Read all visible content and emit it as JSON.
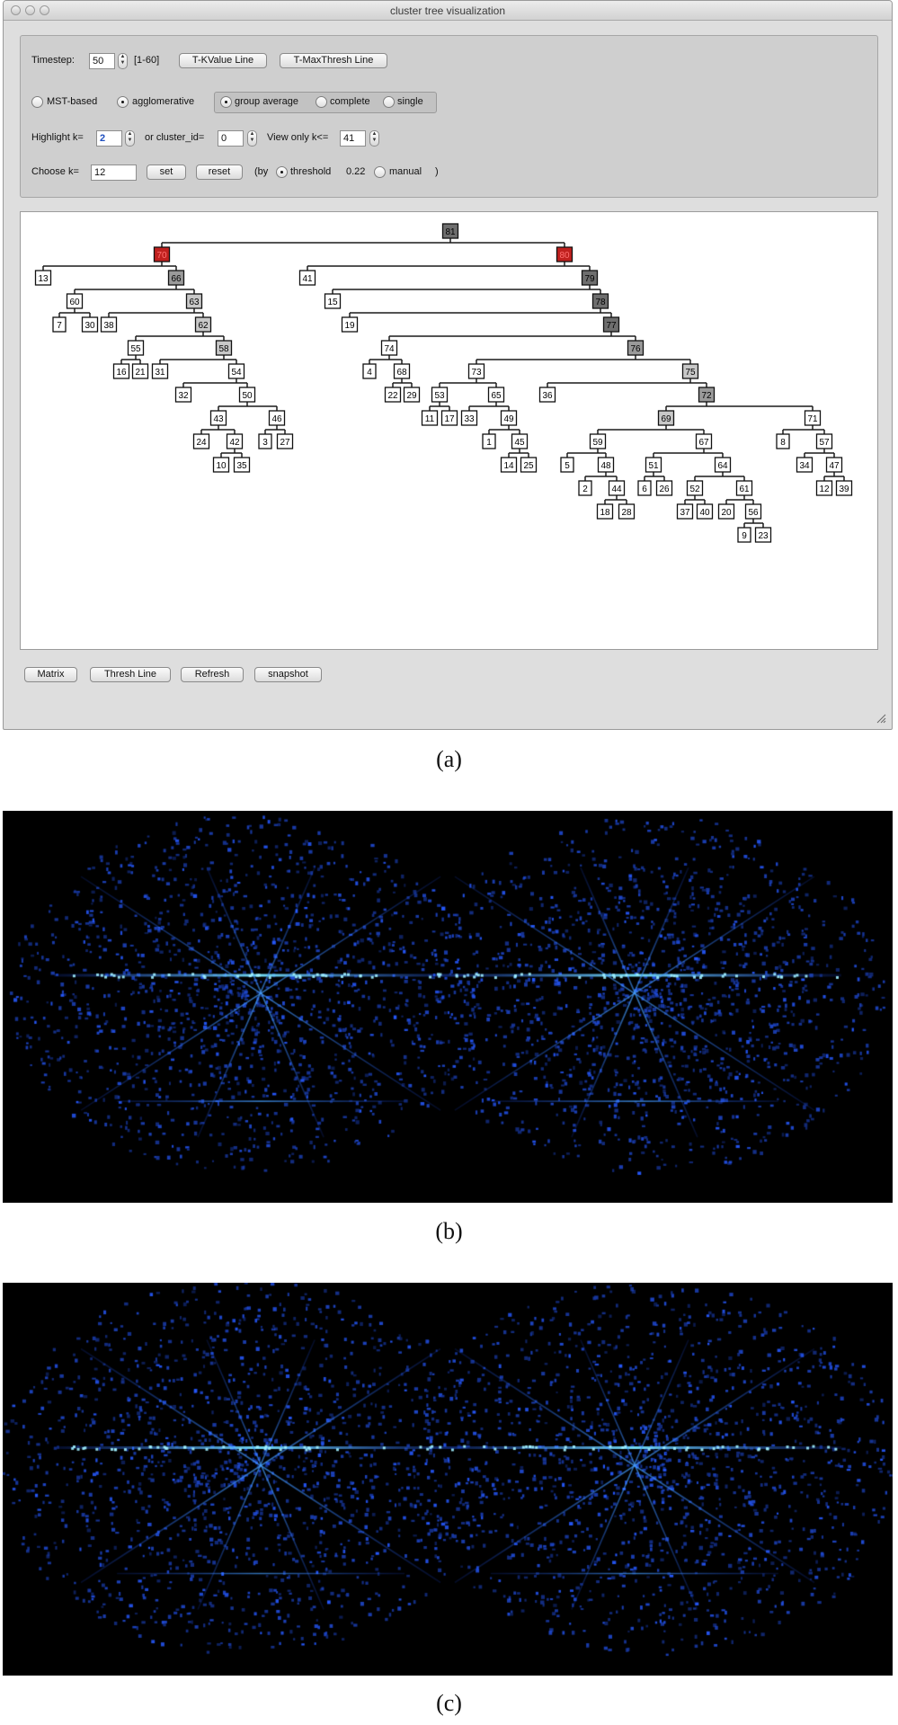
{
  "window": {
    "title": "cluster tree visualization"
  },
  "controls": {
    "timestep_label": "Timestep:",
    "timestep_value": "50",
    "timestep_range": "[1-60]",
    "tkvalue_button": "T-KValue Line",
    "tmaxthresh_button": "T-MaxThresh Line",
    "mst_label": "MST-based",
    "agglomerative_label": "agglomerative",
    "group_average_label": "group average",
    "complete_label": "complete",
    "single_label": "single",
    "highlight_label": "Highlight k=",
    "highlight_value": "2",
    "cluster_id_label": "or cluster_id=",
    "cluster_id_value": "0",
    "view_only_label": "View only k<=",
    "view_only_value": "41",
    "choose_k_label": "Choose k=",
    "choose_k_value": "12",
    "set_button": "set",
    "reset_button": "reset",
    "by_label": "(by",
    "threshold_label": "threshold",
    "threshold_value": "0.22",
    "manual_label": "manual",
    "close_paren": ")"
  },
  "bottom_buttons": {
    "matrix": "Matrix",
    "thresh_line": "Thresh Line",
    "refresh": "Refresh",
    "snapshot": "snapshot"
  },
  "tree": {
    "colors": {
      "highlight": "#c0201e",
      "dark": "#6e6e6e",
      "medium": "#9a9a9a",
      "light": "#c8c8c8",
      "leaf": "#ffffff"
    },
    "nodes": [
      {
        "id": "81",
        "parent": null,
        "shade": "dark"
      },
      {
        "id": "70",
        "parent": "81",
        "shade": "highlight"
      },
      {
        "id": "80",
        "parent": "81",
        "shade": "highlight"
      },
      {
        "id": "13",
        "parent": "70",
        "shade": "leaf"
      },
      {
        "id": "66",
        "parent": "70",
        "shade": "medium"
      },
      {
        "id": "60",
        "parent": "66",
        "shade": "leaf"
      },
      {
        "id": "63",
        "parent": "66",
        "shade": "light"
      },
      {
        "id": "7",
        "parent": "60",
        "shade": "leaf"
      },
      {
        "id": "30",
        "parent": "60",
        "shade": "leaf"
      },
      {
        "id": "38",
        "parent": "63",
        "shade": "leaf"
      },
      {
        "id": "62",
        "parent": "63",
        "shade": "light"
      },
      {
        "id": "55",
        "parent": "62",
        "shade": "leaf"
      },
      {
        "id": "58",
        "parent": "62",
        "shade": "light"
      },
      {
        "id": "16",
        "parent": "55",
        "shade": "leaf"
      },
      {
        "id": "21",
        "parent": "55",
        "shade": "leaf"
      },
      {
        "id": "31",
        "parent": "58",
        "shade": "leaf"
      },
      {
        "id": "54",
        "parent": "58",
        "shade": "leaf"
      },
      {
        "id": "32",
        "parent": "54",
        "shade": "leaf"
      },
      {
        "id": "50",
        "parent": "54",
        "shade": "leaf"
      },
      {
        "id": "43",
        "parent": "50",
        "shade": "leaf"
      },
      {
        "id": "46",
        "parent": "50",
        "shade": "leaf"
      },
      {
        "id": "24",
        "parent": "43",
        "shade": "leaf"
      },
      {
        "id": "42",
        "parent": "43",
        "shade": "leaf"
      },
      {
        "id": "3",
        "parent": "46",
        "shade": "leaf"
      },
      {
        "id": "27",
        "parent": "46",
        "shade": "leaf"
      },
      {
        "id": "10",
        "parent": "42",
        "shade": "leaf"
      },
      {
        "id": "35",
        "parent": "42",
        "shade": "leaf"
      },
      {
        "id": "41",
        "parent": "80",
        "shade": "leaf"
      },
      {
        "id": "79",
        "parent": "80",
        "shade": "dark"
      },
      {
        "id": "15",
        "parent": "79",
        "shade": "leaf"
      },
      {
        "id": "78",
        "parent": "79",
        "shade": "dark"
      },
      {
        "id": "19",
        "parent": "78",
        "shade": "leaf"
      },
      {
        "id": "77",
        "parent": "78",
        "shade": "dark"
      },
      {
        "id": "74",
        "parent": "77",
        "shade": "leaf"
      },
      {
        "id": "76",
        "parent": "77",
        "shade": "medium"
      },
      {
        "id": "4",
        "parent": "74",
        "shade": "leaf"
      },
      {
        "id": "68",
        "parent": "74",
        "shade": "leaf"
      },
      {
        "id": "22",
        "parent": "68",
        "shade": "leaf"
      },
      {
        "id": "29",
        "parent": "68",
        "shade": "leaf"
      },
      {
        "id": "73",
        "parent": "76",
        "shade": "leaf"
      },
      {
        "id": "75",
        "parent": "76",
        "shade": "light"
      },
      {
        "id": "53",
        "parent": "73",
        "shade": "leaf"
      },
      {
        "id": "65",
        "parent": "73",
        "shade": "leaf"
      },
      {
        "id": "11",
        "parent": "53",
        "shade": "leaf"
      },
      {
        "id": "17",
        "parent": "53",
        "shade": "leaf"
      },
      {
        "id": "33",
        "parent": "65",
        "shade": "leaf"
      },
      {
        "id": "49",
        "parent": "65",
        "shade": "leaf"
      },
      {
        "id": "1",
        "parent": "49",
        "shade": "leaf"
      },
      {
        "id": "45",
        "parent": "49",
        "shade": "leaf"
      },
      {
        "id": "14",
        "parent": "45",
        "shade": "leaf"
      },
      {
        "id": "25",
        "parent": "45",
        "shade": "leaf"
      },
      {
        "id": "36",
        "parent": "75",
        "shade": "leaf"
      },
      {
        "id": "72",
        "parent": "75",
        "shade": "medium"
      },
      {
        "id": "69",
        "parent": "72",
        "shade": "light"
      },
      {
        "id": "71",
        "parent": "72",
        "shade": "leaf"
      },
      {
        "id": "59",
        "parent": "69",
        "shade": "leaf"
      },
      {
        "id": "67",
        "parent": "69",
        "shade": "leaf"
      },
      {
        "id": "5",
        "parent": "59",
        "shade": "leaf"
      },
      {
        "id": "48",
        "parent": "59",
        "shade": "leaf"
      },
      {
        "id": "2",
        "parent": "48",
        "shade": "leaf"
      },
      {
        "id": "44",
        "parent": "48",
        "shade": "leaf"
      },
      {
        "id": "18",
        "parent": "44",
        "shade": "leaf"
      },
      {
        "id": "28",
        "parent": "44",
        "shade": "leaf"
      },
      {
        "id": "51",
        "parent": "67",
        "shade": "leaf"
      },
      {
        "id": "64",
        "parent": "67",
        "shade": "leaf"
      },
      {
        "id": "6",
        "parent": "51",
        "shade": "leaf"
      },
      {
        "id": "26",
        "parent": "51",
        "shade": "leaf"
      },
      {
        "id": "52",
        "parent": "64",
        "shade": "leaf"
      },
      {
        "id": "61",
        "parent": "64",
        "shade": "leaf"
      },
      {
        "id": "37",
        "parent": "52",
        "shade": "leaf"
      },
      {
        "id": "40",
        "parent": "52",
        "shade": "leaf"
      },
      {
        "id": "20",
        "parent": "61",
        "shade": "leaf"
      },
      {
        "id": "56",
        "parent": "61",
        "shade": "leaf"
      },
      {
        "id": "9",
        "parent": "56",
        "shade": "leaf"
      },
      {
        "id": "23",
        "parent": "56",
        "shade": "leaf"
      },
      {
        "id": "8",
        "parent": "71",
        "shade": "leaf"
      },
      {
        "id": "57",
        "parent": "71",
        "shade": "leaf"
      },
      {
        "id": "34",
        "parent": "57",
        "shade": "leaf"
      },
      {
        "id": "47",
        "parent": "57",
        "shade": "leaf"
      },
      {
        "id": "12",
        "parent": "47",
        "shade": "leaf"
      },
      {
        "id": "39",
        "parent": "47",
        "shade": "leaf"
      }
    ]
  },
  "captions": {
    "a": "(a)",
    "b": "(b)",
    "c": "(c)"
  }
}
